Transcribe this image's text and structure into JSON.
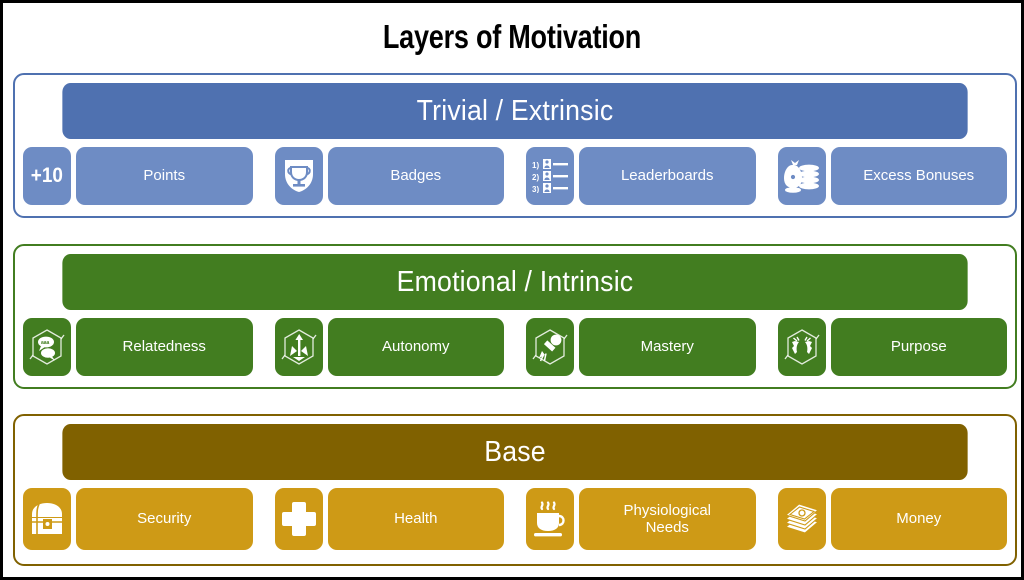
{
  "title": "Layers of Motivation",
  "colors": {
    "background": "#ffffff",
    "outer_border": "#000000",
    "title_text": "#000000",
    "extrinsic_header": "#4F71B0",
    "extrinsic_chip": "#6E8CC4",
    "intrinsic": "#427D20",
    "base_header": "#806100",
    "base_chip": "#CE9A16",
    "chip_text": "#ffffff"
  },
  "layers": [
    {
      "id": "trivial-extrinsic",
      "header": "Trivial / Extrinsic",
      "items": [
        {
          "label": "Points",
          "icon": "plus-ten-icon",
          "icon_text": "+10"
        },
        {
          "label": "Badges",
          "icon": "trophy-shield-icon",
          "icon_text": ""
        },
        {
          "label": "Leaderboards",
          "icon": "ranking-list-icon",
          "icon_text": ""
        },
        {
          "label": "Excess Bonuses",
          "icon": "money-bag-coins-icon",
          "icon_text": ""
        }
      ]
    },
    {
      "id": "emotional-intrinsic",
      "header": "Emotional / Intrinsic",
      "items": [
        {
          "label": "Relatedness",
          "icon": "speech-bubbles-hexagon-icon",
          "icon_text": ""
        },
        {
          "label": "Autonomy",
          "icon": "compass-arrows-hexagon-icon",
          "icon_text": ""
        },
        {
          "label": "Mastery",
          "icon": "paintbrush-hexagon-icon",
          "icon_text": ""
        },
        {
          "label": "Purpose",
          "icon": "open-hands-hexagon-icon",
          "icon_text": ""
        }
      ]
    },
    {
      "id": "base",
      "header": "Base",
      "items": [
        {
          "label": "Security",
          "icon": "treasure-chest-icon",
          "icon_text": ""
        },
        {
          "label": "Health",
          "icon": "medical-cross-icon",
          "icon_text": ""
        },
        {
          "label": "Physiological\nNeeds",
          "icon": "hot-drink-cup-icon",
          "icon_text": ""
        },
        {
          "label": "Money",
          "icon": "cash-stack-icon",
          "icon_text": ""
        }
      ]
    }
  ]
}
